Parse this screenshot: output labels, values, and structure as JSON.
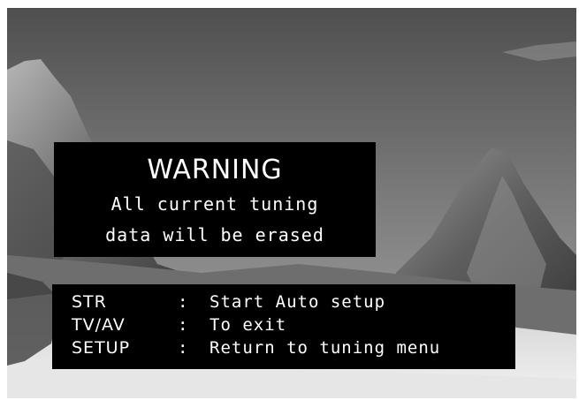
{
  "warning": {
    "title": "WARNING",
    "line1": "All current tuning",
    "line2": "data will be erased"
  },
  "keys": [
    {
      "key": "STR",
      "separator": ":",
      "action": "Start Auto setup"
    },
    {
      "key": "TV/AV",
      "separator": ":",
      "action": "To exit"
    },
    {
      "key": "SETUP",
      "separator": ":",
      "action": "Return to tuning menu"
    }
  ],
  "background": {
    "description_icon": "mountain-landscape-image"
  }
}
